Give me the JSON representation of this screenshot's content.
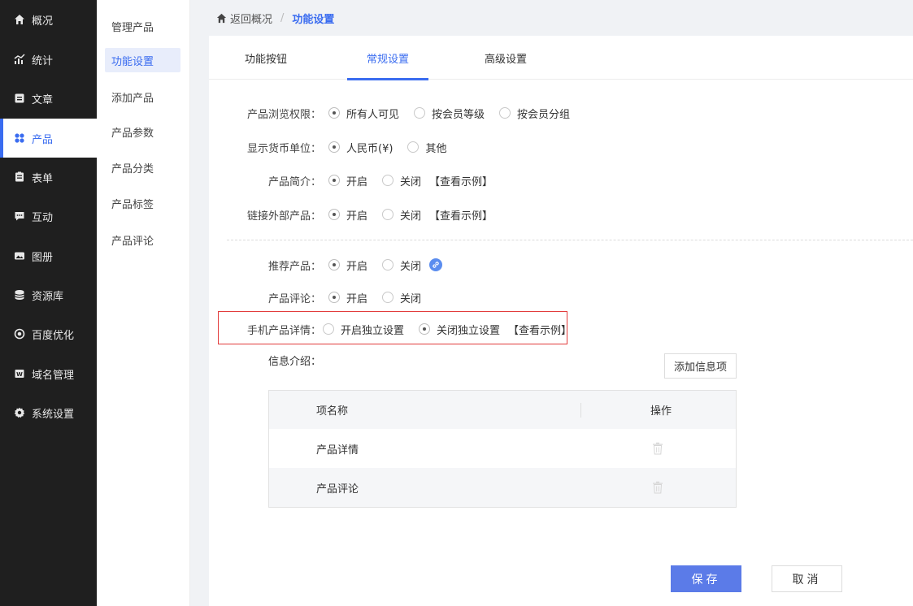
{
  "nav": {
    "items": [
      {
        "label": "概况",
        "icon": "home-icon"
      },
      {
        "label": "统计",
        "icon": "chart-icon"
      },
      {
        "label": "文章",
        "icon": "article-icon"
      },
      {
        "label": "产品",
        "icon": "product-icon",
        "active": true
      },
      {
        "label": "表单",
        "icon": "form-icon"
      },
      {
        "label": "互动",
        "icon": "chat-icon"
      },
      {
        "label": "图册",
        "icon": "album-icon"
      },
      {
        "label": "资源库",
        "icon": "database-icon"
      },
      {
        "label": "百度优化",
        "icon": "seo-icon"
      },
      {
        "label": "域名管理",
        "icon": "domain-icon"
      },
      {
        "label": "系统设置",
        "icon": "gear-icon"
      }
    ]
  },
  "subnav": {
    "items": [
      "管理产品",
      "功能设置",
      "添加产品",
      "产品参数",
      "产品分类",
      "产品标签",
      "产品评论"
    ]
  },
  "breadcrumb": {
    "home": "返回概况",
    "sep": "/",
    "current": "功能设置"
  },
  "tabs": [
    "功能按钮",
    "常规设置",
    "高级设置"
  ],
  "settings": {
    "browse": {
      "label": "产品浏览权限：",
      "options": [
        "所有人可见",
        "按会员等级",
        "按会员分组"
      ]
    },
    "currency": {
      "label": "显示货币单位：",
      "options": [
        "人民币(¥)",
        "其他"
      ]
    },
    "intro": {
      "label": "产品简介：",
      "options": [
        "开启",
        "关闭"
      ],
      "example": "【查看示例】"
    },
    "external": {
      "label": "链接外部产品：",
      "options": [
        "开启",
        "关闭"
      ],
      "example": "【查看示例】"
    },
    "recommend": {
      "label": "推荐产品：",
      "options": [
        "开启",
        "关闭"
      ]
    },
    "review": {
      "label": "产品评论：",
      "options": [
        "开启",
        "关闭"
      ]
    },
    "mobile": {
      "label": "手机产品详情：",
      "options": [
        "开启独立设置",
        "关闭独立设置"
      ],
      "example": "【查看示例】"
    }
  },
  "info": {
    "label": "信息介绍：",
    "add_button": "添加信息项",
    "columns": [
      "项名称",
      "操作"
    ],
    "rows": [
      "产品详情",
      "产品评论"
    ]
  },
  "actions": {
    "save": "保存",
    "cancel": "取消"
  },
  "colors": {
    "accent": "#3a6cf0",
    "save_button": "#5b7be8",
    "highlight_border": "#e23b3b"
  }
}
